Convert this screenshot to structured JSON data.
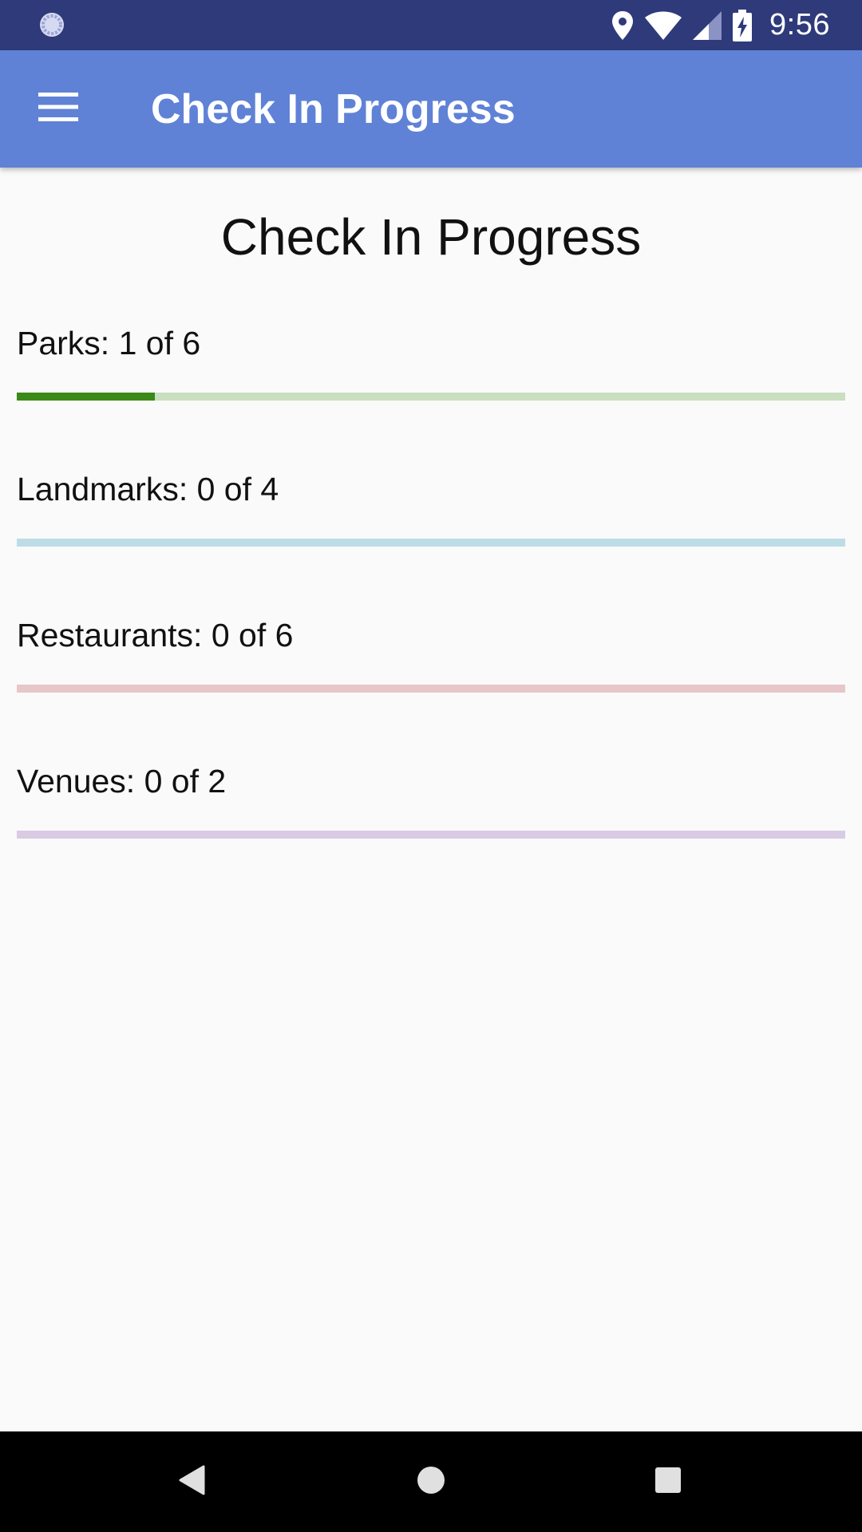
{
  "status_bar": {
    "time": "9:56",
    "icons": [
      "sync-icon",
      "location-icon",
      "wifi-icon",
      "signal-icon",
      "battery-charging-icon"
    ]
  },
  "app_bar": {
    "title": "Check In Progress",
    "menu_icon": "hamburger-menu-icon",
    "color": "#5f82d6"
  },
  "page": {
    "heading": "Check In Progress"
  },
  "progress": [
    {
      "label": "Parks: 1 of 6",
      "done": 1,
      "total": 6,
      "fill_color": "#3a8a17",
      "track_color": "#c9dfbf"
    },
    {
      "label": "Landmarks: 0 of 4",
      "done": 0,
      "total": 4,
      "fill_color": "#2f9bb5",
      "track_color": "#bcdde6"
    },
    {
      "label": "Restaurants: 0 of 6",
      "done": 0,
      "total": 6,
      "fill_color": "#c23b3b",
      "track_color": "#e7c7c9"
    },
    {
      "label": "Venues: 0 of 2",
      "done": 0,
      "total": 2,
      "fill_color": "#7a4bb3",
      "track_color": "#d9cbe4"
    }
  ],
  "nav_bar": {
    "buttons": [
      "back-icon",
      "home-icon",
      "recents-icon"
    ]
  }
}
